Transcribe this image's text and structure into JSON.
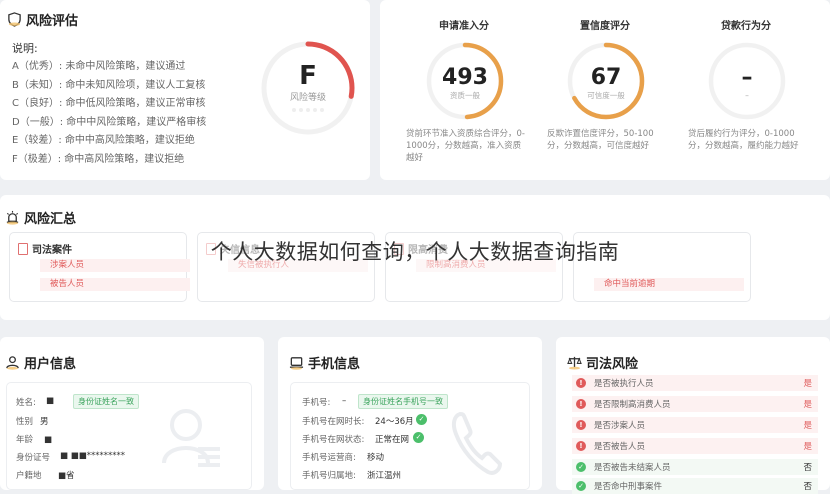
{
  "risk": {
    "title": "风险评估",
    "legend_title": "说明:",
    "legend": [
      "A（优秀）: 未命中风险策略，建议通过",
      "B（未知）: 命中未知风险项，建议人工复核",
      "C（良好）: 命中低风险策略，建议正常审核",
      "D（一般）: 命中中风险策略，建议严格审核",
      "E（较差）: 命中中高风险策略，建议拒绝",
      "F（极差）: 命中高风险策略，建议拒绝"
    ],
    "grade": "F",
    "grade_label": "风险等级",
    "grade_level": 0.28,
    "accent": "#e0544f"
  },
  "scores": [
    {
      "header": "申请准入分",
      "value": "493",
      "label": "资质一般",
      "level": 0.49,
      "color": "#e8a04a",
      "desc": "贷前环节准入资质综合评分，0-1000分，分数越高，准入资质越好"
    },
    {
      "header": "置信度评分",
      "value": "67",
      "label": "可信度一般",
      "level": 0.67,
      "color": "#e8a04a",
      "desc": "反欺诈置信度评分，50-100分，分数越高，可信度越好"
    },
    {
      "header": "贷款行为分",
      "value": "–",
      "label": "–",
      "level": 0,
      "color": "#cccccc",
      "desc": "贷后履约行为评分，0-1000分，分数越高，履约能力越好"
    }
  ],
  "summary": {
    "title": "风险汇总",
    "cards": [
      {
        "head": "司法案件",
        "rows": [
          "涉案人员",
          "被告人员"
        ]
      },
      {
        "head": "失信信息",
        "rows": [
          "失信被执行人"
        ]
      },
      {
        "head": "限高消费",
        "rows": [
          "限制高消费人员"
        ]
      },
      {
        "head": "",
        "rows": [
          "命中当前逾期"
        ]
      }
    ]
  },
  "overlay_text": "个人大数据如何查询，个人大数据查询指南",
  "user": {
    "title": "用户信息",
    "fields": [
      {
        "label": "姓名:",
        "value": "■",
        "badge": "身份证姓名一致"
      },
      {
        "label": "性别",
        "value": "男"
      },
      {
        "label": "年龄",
        "value": "■"
      },
      {
        "label": "身份证号",
        "value": "■ ■■*********"
      },
      {
        "label": "户籍地",
        "value": "■省"
      }
    ]
  },
  "phone": {
    "title": "手机信息",
    "fields": [
      {
        "label": "手机号:",
        "value": "–",
        "badge": "身份证姓名手机号一致"
      },
      {
        "label": "手机号在网时长:",
        "value": "24～36月",
        "check": true
      },
      {
        "label": "手机号在网状态:",
        "value": "正常在网",
        "check": true
      },
      {
        "label": "手机号运营商:",
        "value": "移动"
      },
      {
        "label": "手机号归属地:",
        "value": "浙江温州"
      }
    ]
  },
  "judicial": {
    "title": "司法风险",
    "items": [
      {
        "label": "是否被执行人员",
        "result": "是",
        "hit": true
      },
      {
        "label": "是否限制高消费人员",
        "result": "是",
        "hit": true
      },
      {
        "label": "是否涉案人员",
        "result": "是",
        "hit": true
      },
      {
        "label": "是否被告人员",
        "result": "是",
        "hit": true
      },
      {
        "label": "是否被告未结案人员",
        "result": "否",
        "hit": false
      },
      {
        "label": "是否命中刑事案件",
        "result": "否",
        "hit": false
      }
    ]
  }
}
